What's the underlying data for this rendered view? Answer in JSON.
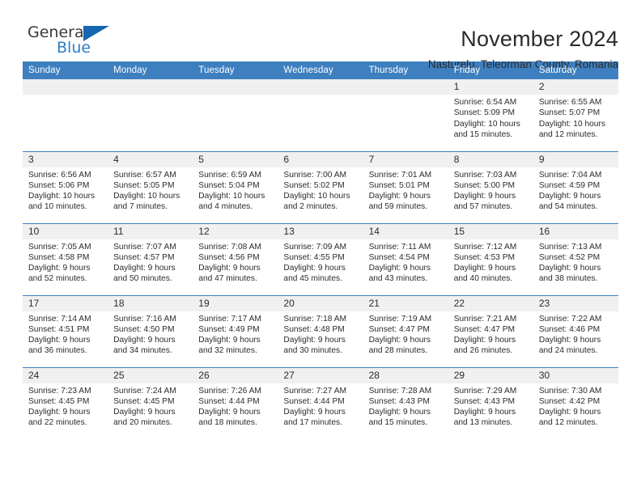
{
  "brand": {
    "line1": "General",
    "line2": "Blue",
    "triangle_color": "#1565b0",
    "text_color": "#3a3a3a",
    "blue_color": "#2a7fc9"
  },
  "header": {
    "title": "November 2024",
    "subtitle": "Nasturelu, Teleorman County, Romania"
  },
  "theme": {
    "header_bg": "#3d7fbf",
    "header_text": "#ffffff",
    "daynum_bg": "#f0f0f0",
    "cell_border": "#3d7fbf"
  },
  "weekdays": [
    "Sunday",
    "Monday",
    "Tuesday",
    "Wednesday",
    "Thursday",
    "Friday",
    "Saturday"
  ],
  "weeks": [
    [
      {
        "day": "",
        "sunrise": "",
        "sunset": "",
        "daylight": "",
        "daylight2": ""
      },
      {
        "day": "",
        "sunrise": "",
        "sunset": "",
        "daylight": "",
        "daylight2": ""
      },
      {
        "day": "",
        "sunrise": "",
        "sunset": "",
        "daylight": "",
        "daylight2": ""
      },
      {
        "day": "",
        "sunrise": "",
        "sunset": "",
        "daylight": "",
        "daylight2": ""
      },
      {
        "day": "",
        "sunrise": "",
        "sunset": "",
        "daylight": "",
        "daylight2": ""
      },
      {
        "day": "1",
        "sunrise": "Sunrise: 6:54 AM",
        "sunset": "Sunset: 5:09 PM",
        "daylight": "Daylight: 10 hours",
        "daylight2": "and 15 minutes."
      },
      {
        "day": "2",
        "sunrise": "Sunrise: 6:55 AM",
        "sunset": "Sunset: 5:07 PM",
        "daylight": "Daylight: 10 hours",
        "daylight2": "and 12 minutes."
      }
    ],
    [
      {
        "day": "3",
        "sunrise": "Sunrise: 6:56 AM",
        "sunset": "Sunset: 5:06 PM",
        "daylight": "Daylight: 10 hours",
        "daylight2": "and 10 minutes."
      },
      {
        "day": "4",
        "sunrise": "Sunrise: 6:57 AM",
        "sunset": "Sunset: 5:05 PM",
        "daylight": "Daylight: 10 hours",
        "daylight2": "and 7 minutes."
      },
      {
        "day": "5",
        "sunrise": "Sunrise: 6:59 AM",
        "sunset": "Sunset: 5:04 PM",
        "daylight": "Daylight: 10 hours",
        "daylight2": "and 4 minutes."
      },
      {
        "day": "6",
        "sunrise": "Sunrise: 7:00 AM",
        "sunset": "Sunset: 5:02 PM",
        "daylight": "Daylight: 10 hours",
        "daylight2": "and 2 minutes."
      },
      {
        "day": "7",
        "sunrise": "Sunrise: 7:01 AM",
        "sunset": "Sunset: 5:01 PM",
        "daylight": "Daylight: 9 hours",
        "daylight2": "and 59 minutes."
      },
      {
        "day": "8",
        "sunrise": "Sunrise: 7:03 AM",
        "sunset": "Sunset: 5:00 PM",
        "daylight": "Daylight: 9 hours",
        "daylight2": "and 57 minutes."
      },
      {
        "day": "9",
        "sunrise": "Sunrise: 7:04 AM",
        "sunset": "Sunset: 4:59 PM",
        "daylight": "Daylight: 9 hours",
        "daylight2": "and 54 minutes."
      }
    ],
    [
      {
        "day": "10",
        "sunrise": "Sunrise: 7:05 AM",
        "sunset": "Sunset: 4:58 PM",
        "daylight": "Daylight: 9 hours",
        "daylight2": "and 52 minutes."
      },
      {
        "day": "11",
        "sunrise": "Sunrise: 7:07 AM",
        "sunset": "Sunset: 4:57 PM",
        "daylight": "Daylight: 9 hours",
        "daylight2": "and 50 minutes."
      },
      {
        "day": "12",
        "sunrise": "Sunrise: 7:08 AM",
        "sunset": "Sunset: 4:56 PM",
        "daylight": "Daylight: 9 hours",
        "daylight2": "and 47 minutes."
      },
      {
        "day": "13",
        "sunrise": "Sunrise: 7:09 AM",
        "sunset": "Sunset: 4:55 PM",
        "daylight": "Daylight: 9 hours",
        "daylight2": "and 45 minutes."
      },
      {
        "day": "14",
        "sunrise": "Sunrise: 7:11 AM",
        "sunset": "Sunset: 4:54 PM",
        "daylight": "Daylight: 9 hours",
        "daylight2": "and 43 minutes."
      },
      {
        "day": "15",
        "sunrise": "Sunrise: 7:12 AM",
        "sunset": "Sunset: 4:53 PM",
        "daylight": "Daylight: 9 hours",
        "daylight2": "and 40 minutes."
      },
      {
        "day": "16",
        "sunrise": "Sunrise: 7:13 AM",
        "sunset": "Sunset: 4:52 PM",
        "daylight": "Daylight: 9 hours",
        "daylight2": "and 38 minutes."
      }
    ],
    [
      {
        "day": "17",
        "sunrise": "Sunrise: 7:14 AM",
        "sunset": "Sunset: 4:51 PM",
        "daylight": "Daylight: 9 hours",
        "daylight2": "and 36 minutes."
      },
      {
        "day": "18",
        "sunrise": "Sunrise: 7:16 AM",
        "sunset": "Sunset: 4:50 PM",
        "daylight": "Daylight: 9 hours",
        "daylight2": "and 34 minutes."
      },
      {
        "day": "19",
        "sunrise": "Sunrise: 7:17 AM",
        "sunset": "Sunset: 4:49 PM",
        "daylight": "Daylight: 9 hours",
        "daylight2": "and 32 minutes."
      },
      {
        "day": "20",
        "sunrise": "Sunrise: 7:18 AM",
        "sunset": "Sunset: 4:48 PM",
        "daylight": "Daylight: 9 hours",
        "daylight2": "and 30 minutes."
      },
      {
        "day": "21",
        "sunrise": "Sunrise: 7:19 AM",
        "sunset": "Sunset: 4:47 PM",
        "daylight": "Daylight: 9 hours",
        "daylight2": "and 28 minutes."
      },
      {
        "day": "22",
        "sunrise": "Sunrise: 7:21 AM",
        "sunset": "Sunset: 4:47 PM",
        "daylight": "Daylight: 9 hours",
        "daylight2": "and 26 minutes."
      },
      {
        "day": "23",
        "sunrise": "Sunrise: 7:22 AM",
        "sunset": "Sunset: 4:46 PM",
        "daylight": "Daylight: 9 hours",
        "daylight2": "and 24 minutes."
      }
    ],
    [
      {
        "day": "24",
        "sunrise": "Sunrise: 7:23 AM",
        "sunset": "Sunset: 4:45 PM",
        "daylight": "Daylight: 9 hours",
        "daylight2": "and 22 minutes."
      },
      {
        "day": "25",
        "sunrise": "Sunrise: 7:24 AM",
        "sunset": "Sunset: 4:45 PM",
        "daylight": "Daylight: 9 hours",
        "daylight2": "and 20 minutes."
      },
      {
        "day": "26",
        "sunrise": "Sunrise: 7:26 AM",
        "sunset": "Sunset: 4:44 PM",
        "daylight": "Daylight: 9 hours",
        "daylight2": "and 18 minutes."
      },
      {
        "day": "27",
        "sunrise": "Sunrise: 7:27 AM",
        "sunset": "Sunset: 4:44 PM",
        "daylight": "Daylight: 9 hours",
        "daylight2": "and 17 minutes."
      },
      {
        "day": "28",
        "sunrise": "Sunrise: 7:28 AM",
        "sunset": "Sunset: 4:43 PM",
        "daylight": "Daylight: 9 hours",
        "daylight2": "and 15 minutes."
      },
      {
        "day": "29",
        "sunrise": "Sunrise: 7:29 AM",
        "sunset": "Sunset: 4:43 PM",
        "daylight": "Daylight: 9 hours",
        "daylight2": "and 13 minutes."
      },
      {
        "day": "30",
        "sunrise": "Sunrise: 7:30 AM",
        "sunset": "Sunset: 4:42 PM",
        "daylight": "Daylight: 9 hours",
        "daylight2": "and 12 minutes."
      }
    ]
  ]
}
